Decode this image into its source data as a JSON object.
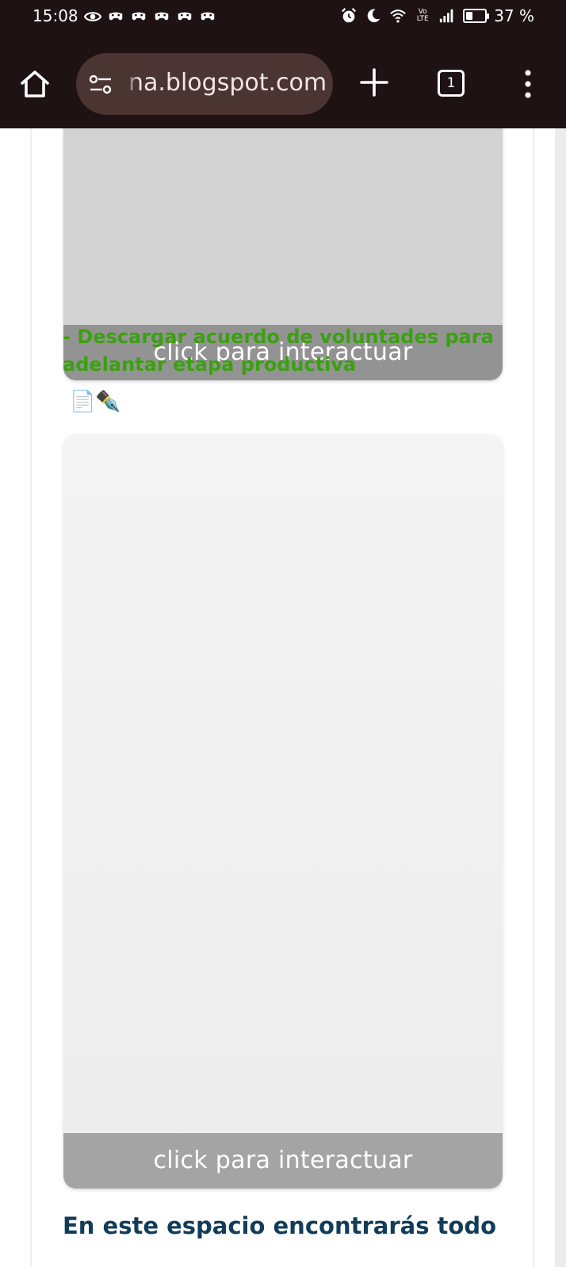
{
  "status_bar": {
    "time": "15:08",
    "battery_text": "37 %",
    "battery_level": 0.37,
    "network_label_top": "Vo",
    "network_label_bottom": "LTE",
    "notification_icons": [
      "eye-icon",
      "game-controller-icon",
      "game-controller-icon",
      "game-controller-icon",
      "game-controller-icon",
      "game-controller-icon"
    ],
    "right_icons": [
      "alarm-icon",
      "moon-icon",
      "wifi-icon",
      "volte-icon",
      "signal-icon",
      "battery-icon"
    ]
  },
  "browser": {
    "url": "na.blogspot.com",
    "tab_count": "1",
    "icons": [
      "home-icon",
      "site-settings-icon",
      "plus-icon",
      "tabs-icon",
      "more-vert-icon"
    ]
  },
  "content": {
    "embed_top_label": "click para interactuar",
    "download_link": "- Descargar acuerdo de voluntades para adelantar etapa productiva",
    "emoji": "📄✒️",
    "embed_bottom_label": "click para interactuar",
    "section_heading": "En este espacio encontrarás todo"
  },
  "colors": {
    "browser_chrome": "#1f1212",
    "url_pill": "#4b3533",
    "link_green": "#3aa10f",
    "heading_navy": "#123d59"
  }
}
